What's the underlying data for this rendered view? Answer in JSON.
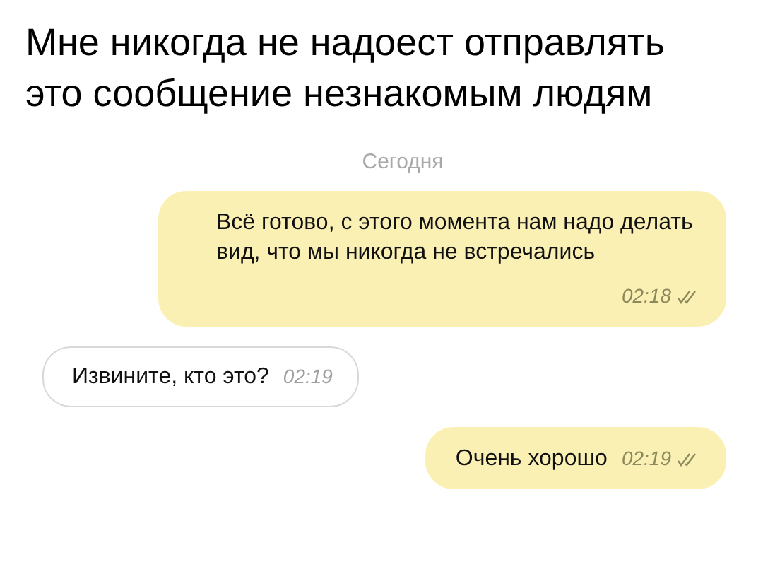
{
  "caption": "Мне никогда не надоест отправлять это сообщение незнакомым людям",
  "chat": {
    "date": "Сегодня",
    "messages": [
      {
        "kind": "outgoing",
        "text": "Всё готово, с этого момента нам надо делать вид, что мы никогда не встречались",
        "time": "02:18"
      },
      {
        "kind": "incoming",
        "text": "Извините, кто это?",
        "time": "02:19"
      },
      {
        "kind": "outgoing",
        "text": "Очень хорошо",
        "time": "02:19"
      }
    ]
  }
}
